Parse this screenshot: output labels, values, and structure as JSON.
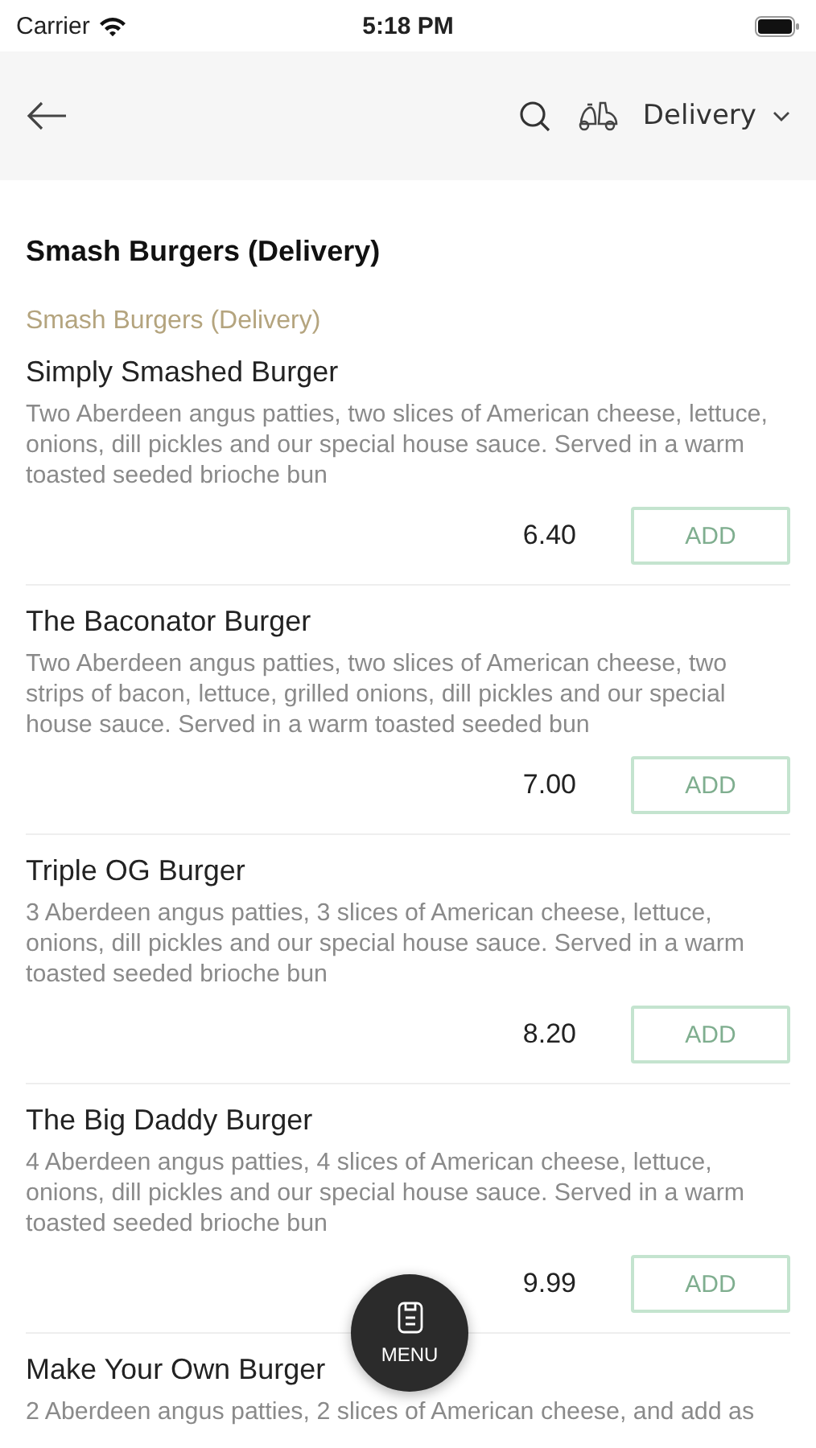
{
  "status_bar": {
    "carrier": "Carrier",
    "time": "5:18 PM"
  },
  "header": {
    "mode": "Delivery"
  },
  "section": {
    "title": "Smash Burgers (Delivery)",
    "category": "Smash Burgers (Delivery)"
  },
  "items": [
    {
      "name": "Simply Smashed Burger",
      "description": "Two Aberdeen angus patties, two slices of American cheese, lettuce, onions, dill pickles and our special house sauce. Served in a warm toasted seeded brioche bun",
      "price": "6.40",
      "button": "ADD"
    },
    {
      "name": "The Baconator Burger",
      "description": "Two Aberdeen angus patties, two slices of American cheese, two strips of bacon, lettuce, grilled onions, dill pickles and our special house sauce. Served in a warm toasted seeded bun",
      "price": "7.00",
      "button": "ADD"
    },
    {
      "name": "Triple OG Burger",
      "description": "3 Aberdeen angus patties, 3 slices of American cheese, lettuce, onions, dill pickles and our special house sauce. Served in a warm toasted seeded brioche bun",
      "price": "8.20",
      "button": "ADD"
    },
    {
      "name": "The Big Daddy Burger",
      "description": "4 Aberdeen angus patties, 4 slices of American cheese, lettuce, onions, dill pickles and our special house sauce. Served in a warm toasted seeded brioche bun",
      "price": "9.99",
      "button": "ADD"
    },
    {
      "name": "Make Your Own Burger",
      "description": "2 Aberdeen angus patties, 2 slices of American cheese, and add as"
    }
  ],
  "fab": {
    "label": "MENU"
  }
}
